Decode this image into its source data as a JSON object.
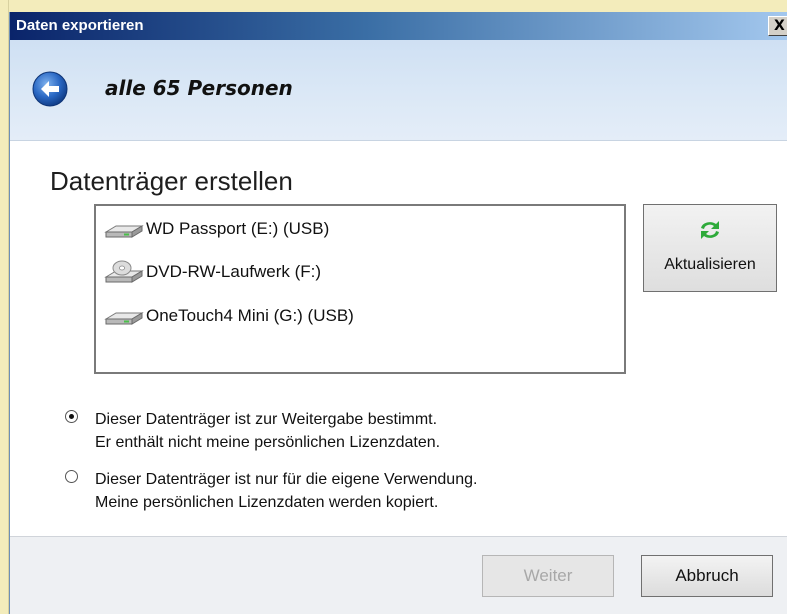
{
  "window": {
    "title": "Daten exportieren",
    "close_glyph": "X"
  },
  "nav": {
    "back_icon": "arrow-left-icon",
    "title": "alle 65 Personen"
  },
  "section": {
    "title": "Datenträger erstellen"
  },
  "drives": [
    {
      "label": "WD Passport (E:) (USB)",
      "icon": "usb-drive-icon"
    },
    {
      "label": "DVD-RW-Laufwerk (F:)",
      "icon": "dvd-drive-icon"
    },
    {
      "label": "OneTouch4 Mini (G:) (USB)",
      "icon": "usb-drive-icon"
    }
  ],
  "refresh": {
    "label": "Aktualisieren",
    "icon": "refresh-icon"
  },
  "options": [
    {
      "line1": "Dieser Datenträger ist zur Weitergabe bestimmt.",
      "line2": "Er enthält nicht meine persönlichen Lizenzdaten.",
      "checked": true
    },
    {
      "line1": "Dieser Datenträger ist nur für die eigene Verwendung.",
      "line2": "Meine persönlichen Lizenzdaten werden kopiert.",
      "checked": false
    }
  ],
  "buttons": {
    "next": "Weiter",
    "next_enabled": false,
    "cancel": "Abbruch"
  },
  "colors": {
    "titlebar_start": "#0a246a",
    "header_bg": "#d6e5f5",
    "refresh_green": "#2eaa3a"
  }
}
